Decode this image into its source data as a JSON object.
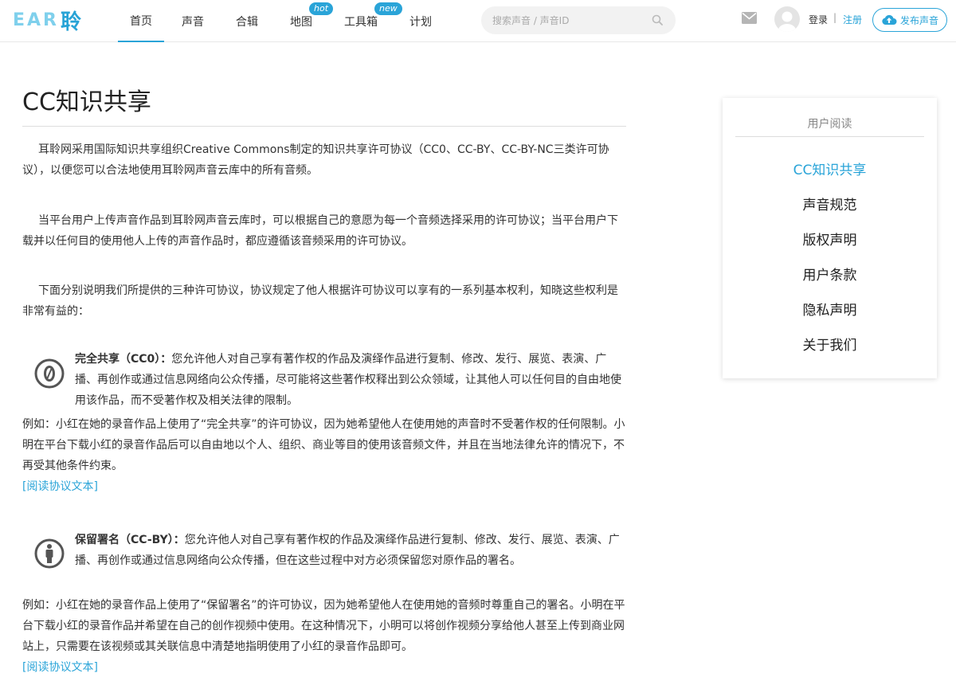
{
  "header": {
    "logo_latin": "EAR",
    "logo_cn": "聆",
    "nav": [
      {
        "label": "首页",
        "active": true
      },
      {
        "label": "声音"
      },
      {
        "label": "合辑"
      },
      {
        "label": "地图",
        "badge": "hot"
      },
      {
        "label": "工具箱",
        "badge": "new"
      },
      {
        "label": "计划"
      }
    ],
    "search_placeholder": "搜索声音 / 声音ID",
    "login": "登录",
    "separator": "|",
    "register": "注册",
    "publish": "发布声音",
    "accent_color": "#2aa4d8"
  },
  "page": {
    "title": "CC知识共享",
    "paragraphs": [
      "耳聆网采用国际知识共享组织Creative Commons制定的知识共享许可协议（CC0、CC-BY、CC-BY-NC三类许可协议），以便您可以合法地使用耳聆网声音云库中的所有音频。",
      "当平台用户上传声音作品到耳聆网声音云库时，可以根据自己的意愿为每一个音频选择采用的许可协议；当平台用户下载并以任何目的使用他人上传的声音作品时，都应遵循该音频采用的许可协议。",
      "下面分别说明我们所提供的三种许可协议，协议规定了他人根据许可协议可以享有的一系列基本权利，知晓这些权利是非常有益的："
    ],
    "licenses": [
      {
        "icon": "cc-zero-icon",
        "name": "完全共享（CC0）：",
        "description": "您允许他人对自己享有著作权的作品及演绎作品进行复制、修改、发行、展览、表演、广播、再创作或通过信息网络向公众传播，尽可能将这些著作权释出到公众领域，让其他人可以任何目的自由地使用该作品，而不受著作权及相关法律的限制。",
        "example": "例如：小红在她的录音作品上使用了“完全共享”的许可协议，因为她希望他人在使用她的声音时不受著作权的任何限制。小明在平台下载小红的录音作品后可以自由地以个人、组织、商业等目的使用该音频文件，并且在当地法律允许的情况下，不再受其他条件约束。",
        "link": "[阅读协议文本]"
      },
      {
        "icon": "cc-by-icon",
        "name": "保留署名（CC-BY）：",
        "description": "您允许他人对自己享有著作权的作品及演绎作品进行复制、修改、发行、展览、表演、广播、再创作或通过信息网络向公众传播，但在这些过程中对方必须保留您对原作品的署名。",
        "example": "例如：小红在她的录音作品上使用了“保留署名”的许可协议，因为她希望他人在使用她的音频时尊重自己的署名。小明在平台下载小红的录音作品并希望在自己的创作视频中使用。在这种情况下，小明可以将创作视频分享给他人甚至上传到商业网站上，只需要在该视频或其关联信息中清楚地指明使用了小红的录音作品即可。",
        "link": "[阅读协议文本]"
      }
    ]
  },
  "sidebar": {
    "heading": "用户阅读",
    "items": [
      {
        "label": "CC知识共享",
        "active": true
      },
      {
        "label": "声音规范"
      },
      {
        "label": "版权声明"
      },
      {
        "label": "用户条款"
      },
      {
        "label": "隐私声明"
      },
      {
        "label": "关于我们"
      }
    ]
  }
}
